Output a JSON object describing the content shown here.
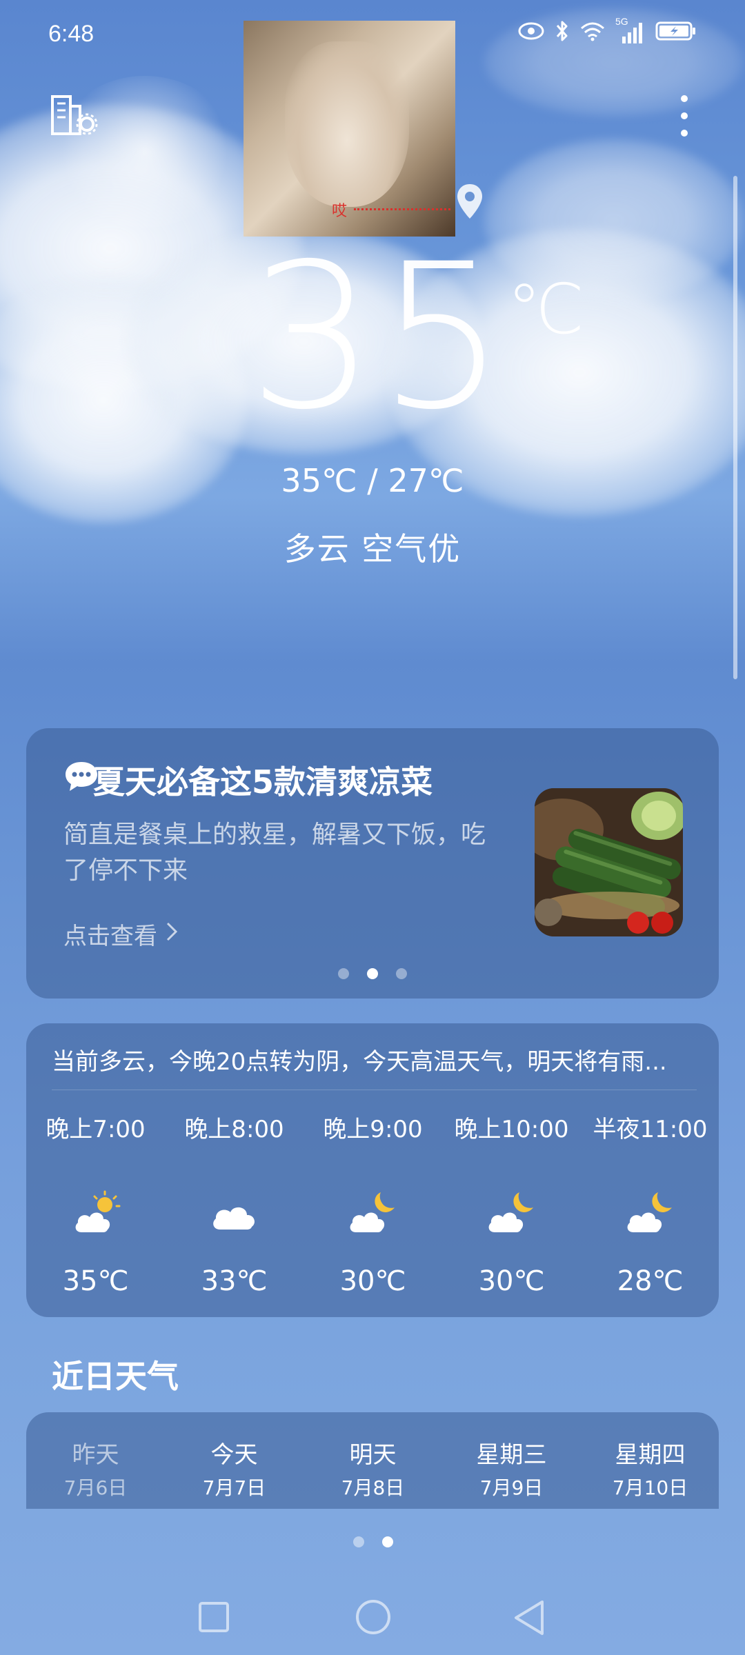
{
  "status_bar": {
    "time": "6:48",
    "network_label": "5G",
    "icons": [
      "eye-icon",
      "bluetooth-icon",
      "wifi-icon",
      "signal-icon",
      "battery-charging-icon"
    ]
  },
  "header": {
    "city_manage_icon": "city-settings-icon",
    "more_icon": "more-vertical-icon",
    "photo_caption": "哎",
    "location_icon": "location-pin-icon"
  },
  "current": {
    "temperature": "35",
    "unit": "℃",
    "range": "35℃ / 27℃",
    "condition": "多云  空气优"
  },
  "news_card": {
    "title": "夏天必备这5款清爽凉菜",
    "description": "简直是餐桌上的救星，解暑又下饭，吃了停不下来",
    "link": "点击查看",
    "pager_active_index": 1,
    "pager_count": 3
  },
  "hourly": {
    "summary": "当前多云，今晚20点转为阴，今天高温天气，明天将有雨...",
    "items": [
      {
        "time": "晚上7:00",
        "icon": "sun-cloud-icon",
        "temp": "35℃"
      },
      {
        "time": "晚上8:00",
        "icon": "cloud-icon",
        "temp": "33℃"
      },
      {
        "time": "晚上9:00",
        "icon": "moon-cloud-icon",
        "temp": "30℃"
      },
      {
        "time": "晚上10:00",
        "icon": "moon-cloud-icon",
        "temp": "30℃"
      },
      {
        "time": "半夜11:00",
        "icon": "moon-cloud-icon",
        "temp": "28℃"
      }
    ]
  },
  "daily": {
    "title": "近日天气",
    "items": [
      {
        "day": "昨天",
        "date": "7月6日",
        "past": true
      },
      {
        "day": "今天",
        "date": "7月7日",
        "past": false
      },
      {
        "day": "明天",
        "date": "7月8日",
        "past": false
      },
      {
        "day": "星期三",
        "date": "7月9日",
        "past": false
      },
      {
        "day": "星期四",
        "date": "7月10日",
        "past": false
      }
    ]
  },
  "page_indicator": {
    "count": 2,
    "active_index": 1
  },
  "nav_bar": {
    "icons": [
      "recent-apps-icon",
      "home-icon",
      "back-icon"
    ]
  },
  "colors": {
    "card_bg": "#3a5c96",
    "sun": "#f6c33a",
    "moon": "#f6c33a",
    "caption_red": "#d9312c"
  }
}
